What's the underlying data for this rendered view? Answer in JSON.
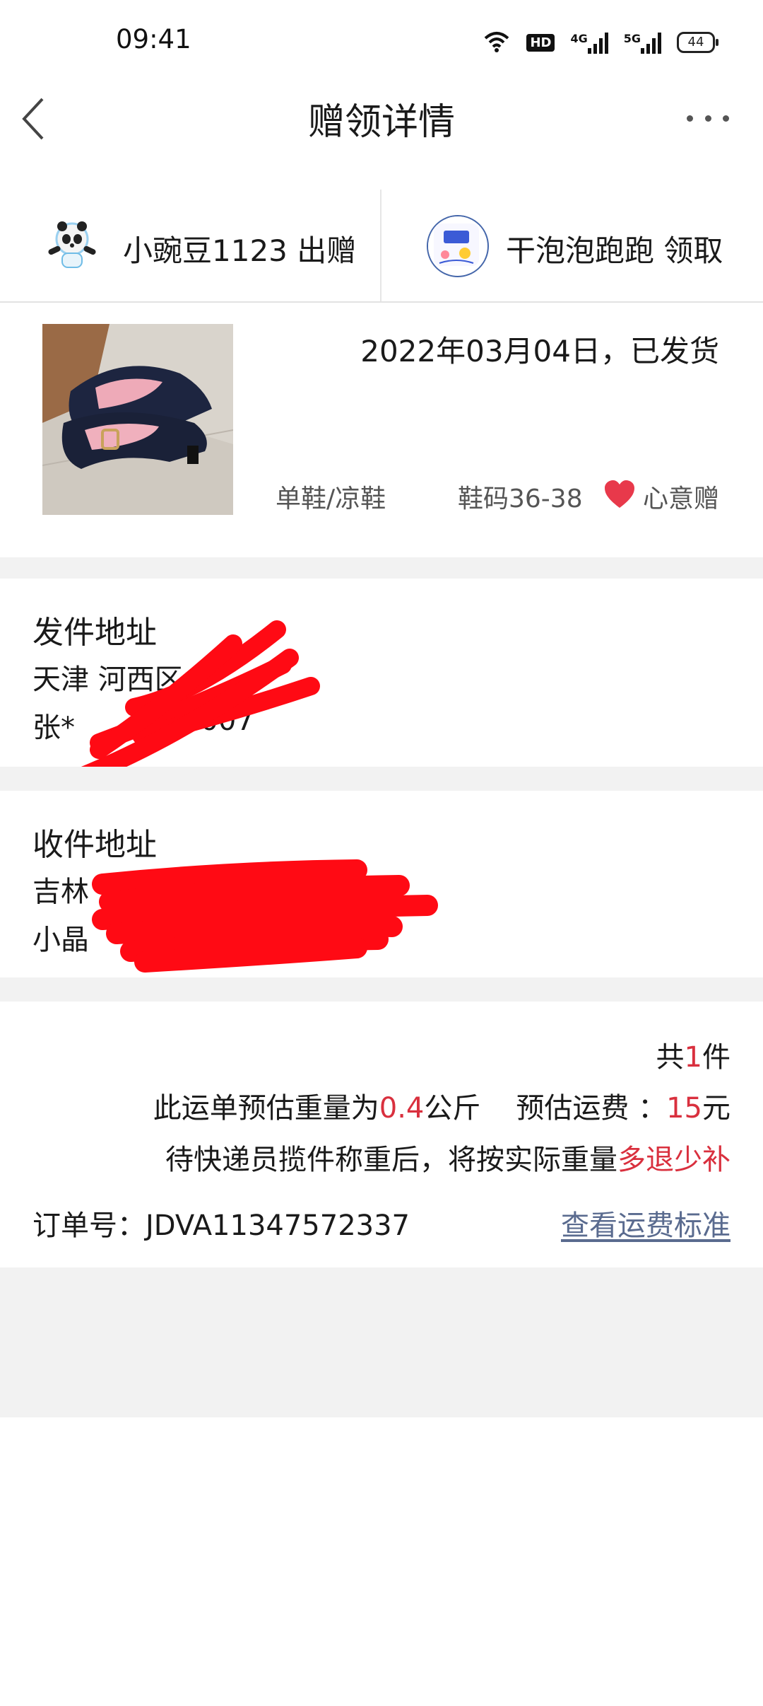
{
  "status_bar": {
    "time": "09:41",
    "hd": "HD",
    "net1": "4G",
    "net2": "5G",
    "battery": "44",
    "icons": [
      "wifi-icon",
      "hd-icon",
      "signal-4g-icon",
      "signal-5g-icon",
      "battery-icon"
    ]
  },
  "header": {
    "title": "赠领详情",
    "back_icon": "chevron-left-icon",
    "more_icon": "more-dots-icon"
  },
  "giver": {
    "name": "小豌豆1123",
    "action": "出赠"
  },
  "receiver": {
    "name": "干泡泡跑跑",
    "action": "领取"
  },
  "item": {
    "status": "2022年03月04日，已发货",
    "category": "单鞋/凉鞋",
    "size": "鞋码36-38",
    "tag": "心意赠",
    "tag_color": "#e8394b"
  },
  "sender_address": {
    "title": "发件地址",
    "line1": "天津 河西区",
    "line2_prefix": "张*",
    "line2_suffix": "1007"
  },
  "receiver_address": {
    "title": "收件地址",
    "line1": "吉林",
    "line2": "小晶"
  },
  "summary": {
    "count_prefix": "共",
    "count": "1",
    "count_suffix": "件",
    "weight_prefix": "此运单预估重量为",
    "weight": "0.4",
    "weight_unit": "公斤",
    "fee_label": "预估运费 ：",
    "fee": "15",
    "fee_unit": "元",
    "note_prefix": "待快递员揽件称重后，将按实际重量",
    "note_highlight": "多退少补"
  },
  "order": {
    "label": "订单号：JDVA11347572337",
    "link": "查看运费标准"
  },
  "colors": {
    "accent_red": "#d9303e",
    "link": "#5a6b8f",
    "band": "#f2f2f2"
  }
}
